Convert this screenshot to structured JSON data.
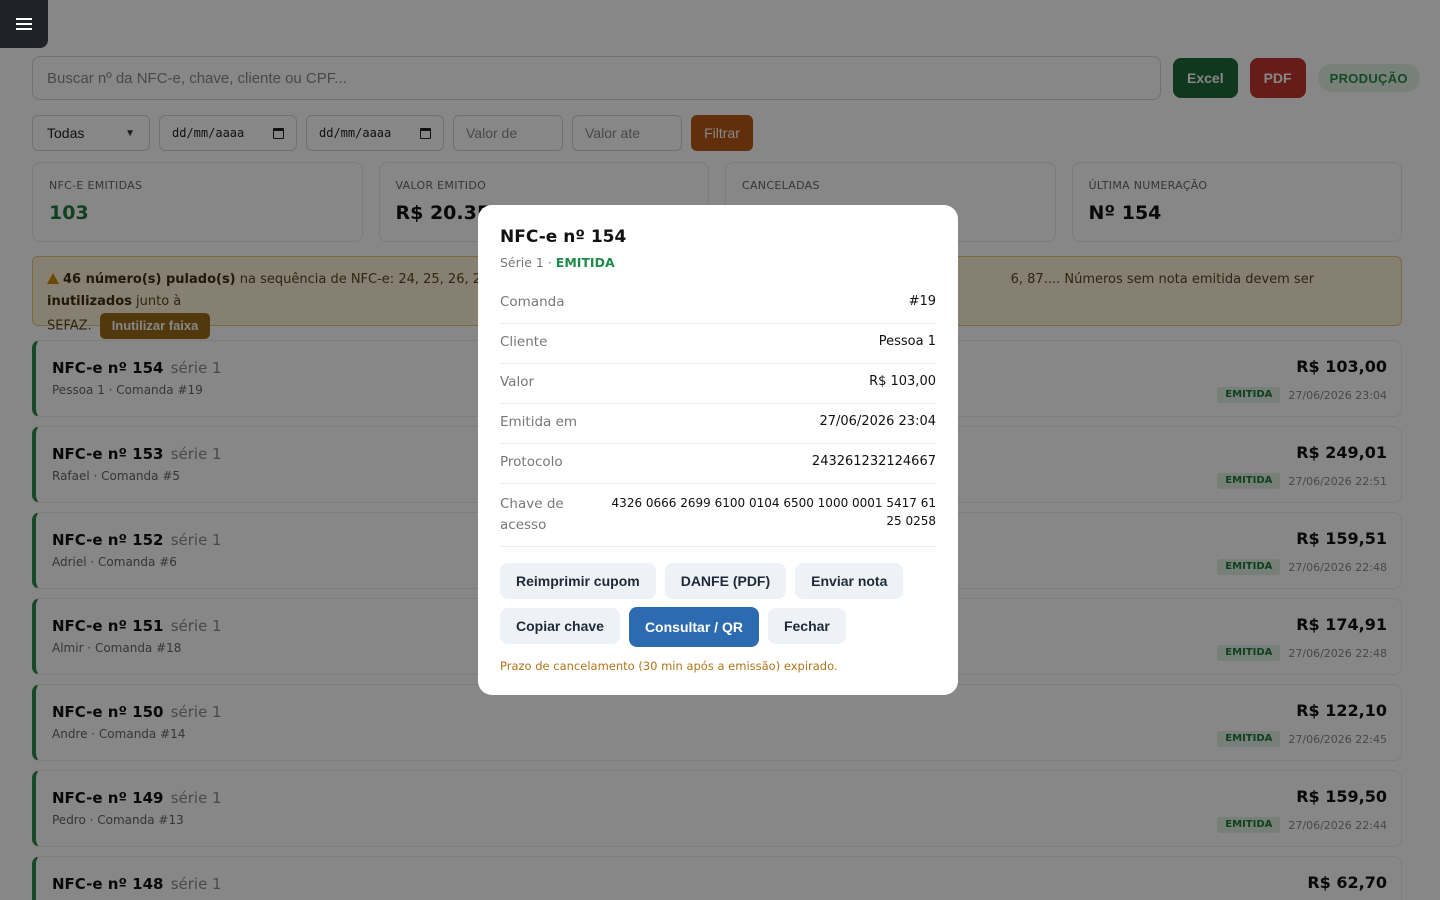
{
  "search": {
    "placeholder": "Buscar nº da NFC-e, chave, cliente ou CPF..."
  },
  "toolbar": {
    "excel_label": "Excel",
    "pdf_label": "PDF",
    "env_badge": "PRODUÇÃO"
  },
  "filters": {
    "status_value": "Todas",
    "date_from_placeholder": "dd/mm/aaaa",
    "date_to_placeholder": "dd/mm/aaaa",
    "value_from_placeholder": "Valor de",
    "value_to_placeholder": "Valor ate",
    "filter_label": "Filtrar"
  },
  "stats": [
    {
      "label": "NFC-E EMITIDAS",
      "value": "103"
    },
    {
      "label": "VALOR EMITIDO",
      "value": "R$ 20.35"
    },
    {
      "label": "CANCELADAS",
      "value": ""
    },
    {
      "label": "ÚLTIMA NUMERAÇÃO",
      "value": "Nº 154"
    }
  ],
  "warning": {
    "count_text": "46 número(s) pulado(s)",
    "middle_text": " na sequência de NFC-e: 24, 25, 26, 27, 28, 2",
    "tail_text": "6, 87.... Números sem nota emitida devem ser ",
    "bold_word": "inutilizados",
    "end_text": " junto à",
    "line2": "SEFAZ.",
    "button": "Inutilizar faixa"
  },
  "notes": [
    {
      "title": "NFC-e nº 154",
      "serie": "série 1",
      "sub": "Pessoa 1 · Comanda #19",
      "value": "R$ 103,00",
      "status": "EMITIDA",
      "date": "27/06/2026 23:04"
    },
    {
      "title": "NFC-e nº 153",
      "serie": "série 1",
      "sub": "Rafael · Comanda #5",
      "value": "R$ 249,01",
      "status": "EMITIDA",
      "date": "27/06/2026 22:51"
    },
    {
      "title": "NFC-e nº 152",
      "serie": "série 1",
      "sub": "Adriel · Comanda #6",
      "value": "R$ 159,51",
      "status": "EMITIDA",
      "date": "27/06/2026 22:48"
    },
    {
      "title": "NFC-e nº 151",
      "serie": "série 1",
      "sub": "Almir · Comanda #18",
      "value": "R$ 174,91",
      "status": "EMITIDA",
      "date": "27/06/2026 22:48"
    },
    {
      "title": "NFC-e nº 150",
      "serie": "série 1",
      "sub": "Andre · Comanda #14",
      "value": "R$ 122,10",
      "status": "EMITIDA",
      "date": "27/06/2026 22:45"
    },
    {
      "title": "NFC-e nº 149",
      "serie": "série 1",
      "sub": "Pedro · Comanda #13",
      "value": "R$ 159,50",
      "status": "EMITIDA",
      "date": "27/06/2026 22:44"
    },
    {
      "title": "NFC-e nº 148",
      "serie": "série 1",
      "sub": "",
      "value": "R$ 62,70",
      "status": "",
      "date": ""
    }
  ],
  "modal": {
    "title": "NFC-e nº 154",
    "serie": "Série 1 · ",
    "status": "EMITIDA",
    "fields": [
      {
        "label": "Comanda",
        "value": "#19"
      },
      {
        "label": "Cliente",
        "value": "Pessoa 1"
      },
      {
        "label": "Valor",
        "value": "R$ 103,00"
      },
      {
        "label": "Emitida em",
        "value": "27/06/2026 23:04"
      },
      {
        "label": "Protocolo",
        "value": "243261232124667"
      }
    ],
    "key_label": "Chave de acesso",
    "key_value": "4326 0666 2699 6100 0104 6500 1000 0001 5417 6125 0258",
    "actions": {
      "reprint": "Reimprimir cupom",
      "danfe": "DANFE (PDF)",
      "send": "Enviar nota",
      "copy": "Copiar chave",
      "consult": "Consultar / QR",
      "close": "Fechar"
    },
    "note": "Prazo de cancelamento (30 min após a emissão) expirado."
  }
}
